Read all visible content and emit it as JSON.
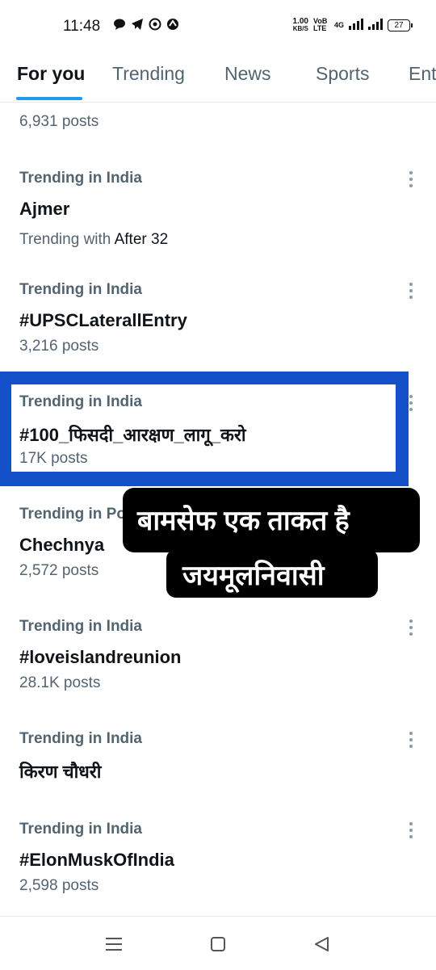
{
  "status": {
    "time": "11:48",
    "speed_top": "1.00",
    "speed_unit": "KB/S",
    "network": "VoB LTE",
    "net_type": "4G",
    "battery": "27"
  },
  "tabs": [
    {
      "label": "For you"
    },
    {
      "label": "Trending"
    },
    {
      "label": "News"
    },
    {
      "label": "Sports"
    },
    {
      "label": "Ent"
    }
  ],
  "feed": {
    "top_partial_posts": "6,931 posts",
    "items": [
      {
        "context": "Trending in India",
        "name": "Ajmer",
        "meta_prefix": "Trending with ",
        "meta_highlight": "After 32"
      },
      {
        "context": "Trending in India",
        "name": "#UPSCLaterallEntry",
        "meta": "3,216 posts"
      },
      {
        "context": "Trending in India",
        "name": "#100_फिसदी_आरक्षण_लागू_करो",
        "meta": "17K posts"
      },
      {
        "context": "Trending in Po",
        "name": "Chechnya",
        "meta": "2,572 posts"
      },
      {
        "context": "Trending in India",
        "name": "#loveislandreunion",
        "meta": "28.1K posts"
      },
      {
        "context": "Trending in India",
        "name": "किरण चौधरी",
        "meta": ""
      },
      {
        "context": "Trending in India",
        "name": "#ElonMuskOfIndia",
        "meta": "2,598 posts"
      }
    ]
  },
  "overlay": {
    "line1": "बामसेफ एक ताकत है",
    "line2": "जयमूलनिवासी"
  },
  "colors": {
    "accent": "#1d9bf0",
    "highlight_border": "#1450c8",
    "secondary_text": "#536471",
    "primary_text": "#0f1419"
  }
}
